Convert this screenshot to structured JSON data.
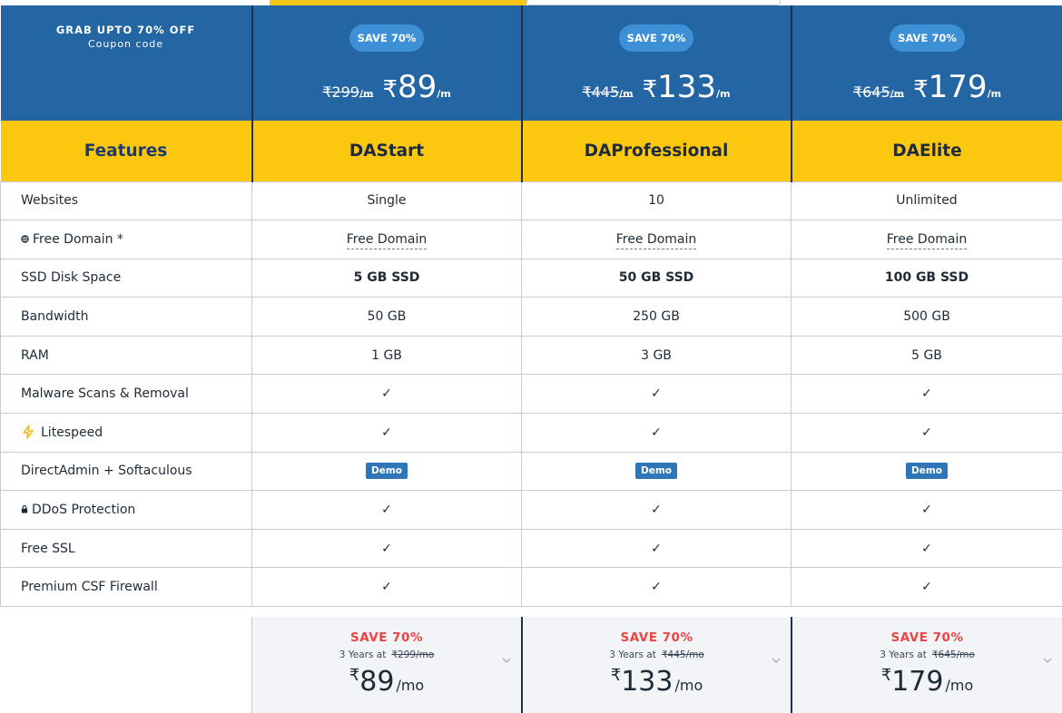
{
  "offer": {
    "headline": "GRAB UPTO 70% OFF",
    "sub": "Coupon code"
  },
  "plans": [
    {
      "save": "SAVE 70%",
      "old_price": "₹299",
      "per": "/m",
      "currency": "₹",
      "price": "89",
      "name": "DAStart",
      "footer": {
        "save": "SAVE 70%",
        "years": "3 Years at",
        "old": "₹299/mo",
        "currency": "₹",
        "price": "89",
        "unit": "/mo"
      }
    },
    {
      "save": "SAVE 70%",
      "old_price": "₹445",
      "per": "/m",
      "currency": "₹",
      "price": "133",
      "name": "DAProfessional",
      "footer": {
        "save": "SAVE 70%",
        "years": "3 Years at",
        "old": "₹445/mo",
        "currency": "₹",
        "price": "133",
        "unit": "/mo"
      }
    },
    {
      "save": "SAVE 70%",
      "old_price": "₹645",
      "per": "/m",
      "currency": "₹",
      "price": "179",
      "name": "DAElite",
      "footer": {
        "save": "SAVE 70%",
        "years": "3 Years at",
        "old": "₹645/mo",
        "currency": "₹",
        "price": "179",
        "unit": "/mo"
      }
    }
  ],
  "features_title": "Features",
  "rows": [
    {
      "label": "Websites",
      "values": [
        "Single",
        "10",
        "Unlimited"
      ]
    },
    {
      "label": "Free Domain *",
      "values": [
        "Free Domain",
        "Free Domain",
        "Free Domain"
      ]
    },
    {
      "label": "SSD Disk Space",
      "values": [
        "5 GB SSD",
        "50 GB SSD",
        "100 GB SSD"
      ]
    },
    {
      "label": "Bandwidth",
      "values": [
        "50 GB",
        "250 GB",
        "500 GB"
      ]
    },
    {
      "label": "RAM",
      "values": [
        "1 GB",
        "3 GB",
        "5 GB"
      ]
    },
    {
      "label": "Malware Scans & Removal",
      "values": [
        "✓",
        "✓",
        "✓"
      ]
    },
    {
      "label": "Litespeed",
      "values": [
        "✓",
        "✓",
        "✓"
      ]
    },
    {
      "label": "DirectAdmin + Softaculous",
      "values": [
        "Demo",
        "Demo",
        "Demo"
      ]
    },
    {
      "label": "DDoS Protection",
      "values": [
        "✓",
        "✓",
        "✓"
      ]
    },
    {
      "label": "Free SSL",
      "values": [
        "✓",
        "✓",
        "✓"
      ]
    },
    {
      "label": "Premium CSF Firewall",
      "values": [
        "✓",
        "✓",
        "✓"
      ]
    }
  ],
  "colors": {
    "header_blue": "#2465a3",
    "pill_blue": "#3d8fd6",
    "name_yellow": "#fcc70f",
    "save_red": "#ec4444",
    "ssd_gold": "#f5c518",
    "ssd_blue": "#2f7ec2"
  },
  "icons": {
    "domain": "globe-icon",
    "litespeed": "lightning-bolt-icon",
    "ddos": "lock-icon",
    "footer": "chevron-down-icon"
  }
}
